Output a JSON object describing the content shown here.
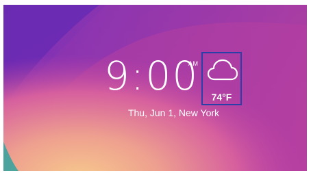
{
  "lockscreen": {
    "time": "9:00",
    "ampm": "AM",
    "date": "Thu, Jun 1, New York"
  },
  "weather": {
    "icon": "cloud-icon",
    "temperature": "74°F"
  },
  "colors": {
    "highlight_border": "#2a3fa8",
    "text": "#ffffff",
    "wallpaper_top": "#7a2fb0",
    "wallpaper_glow": "#f2b98a"
  }
}
